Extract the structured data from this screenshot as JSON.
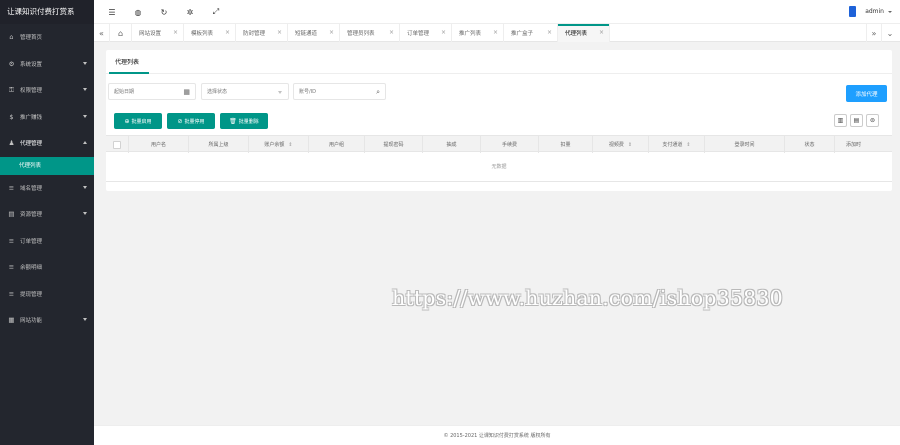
{
  "app": {
    "title": "让课知识付费打赏系"
  },
  "colors": {
    "sidebar": "#23262e",
    "accent": "#009688",
    "primary": "#1e9fff"
  },
  "sidebar": {
    "items": [
      {
        "label": "管理首页",
        "icon": "home-icon",
        "arrow": ""
      },
      {
        "label": "系统设置",
        "icon": "gear-icon",
        "arrow": "down"
      },
      {
        "label": "权限管理",
        "icon": "key-icon",
        "arrow": "down"
      },
      {
        "label": "推广赚钱",
        "icon": "money-icon",
        "arrow": "down"
      },
      {
        "label": "代理管理",
        "icon": "user-icon",
        "arrow": "up"
      },
      {
        "label": "域名管理",
        "icon": "list-icon",
        "arrow": "down"
      },
      {
        "label": "资源管理",
        "icon": "resource-icon",
        "arrow": "down"
      },
      {
        "label": "订单管理",
        "icon": "list-icon",
        "arrow": ""
      },
      {
        "label": "余额明细",
        "icon": "list-icon",
        "arrow": ""
      },
      {
        "label": "提现管理",
        "icon": "list-icon",
        "arrow": ""
      },
      {
        "label": "网站功能",
        "icon": "grid-icon",
        "arrow": "down"
      }
    ],
    "active_sub": "代理列表"
  },
  "header": {
    "icons": [
      "menu-icon",
      "globe-icon",
      "refresh-icon",
      "theme-icon",
      "fullscreen-icon"
    ],
    "user": "admin"
  },
  "tabs": [
    {
      "label": "网站设置"
    },
    {
      "label": "模板列表"
    },
    {
      "label": "防封管理"
    },
    {
      "label": "短链通道"
    },
    {
      "label": "管理员列表"
    },
    {
      "label": "订单管理"
    },
    {
      "label": "推广列表"
    },
    {
      "label": "推广盒子"
    },
    {
      "label": "代理列表",
      "active": true
    }
  ],
  "panel": {
    "tab": "代理列表",
    "filters": {
      "date_placeholder": "起始日期",
      "select_placeholder": "选择状态",
      "search_placeholder": "账号/ID"
    },
    "add_button": "添加代理",
    "batch": {
      "enable": "批量启用",
      "disable": "批量停用",
      "delete": "批量删除"
    },
    "columns": [
      "用户名",
      "所属上级",
      "账户余额",
      "用户组",
      "提现密码",
      "抽成",
      "手续费",
      "扣量",
      "视频费",
      "支付通道",
      "登录时间",
      "状态",
      "添加时"
    ],
    "empty": "无数据"
  },
  "watermark": "https://www.huzhan.com/ishop35830",
  "footer": "© 2015-2021 让课知识付费打赏系统 版权所有"
}
